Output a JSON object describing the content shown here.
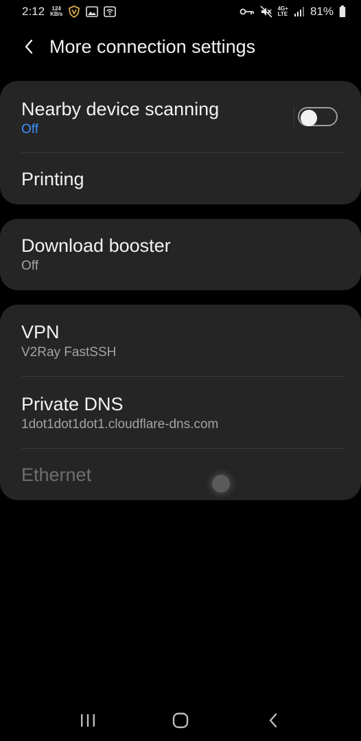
{
  "status_bar": {
    "time": "2:12",
    "net_speed_value": "124",
    "net_speed_unit": "KB/s",
    "lte_top": "4G+",
    "lte_bottom": "LTE",
    "battery": "81%"
  },
  "header": {
    "title": "More connection settings"
  },
  "card1": {
    "nearby": {
      "title": "Nearby device scanning",
      "subtitle": "Off",
      "toggle_on": false
    },
    "printing": {
      "title": "Printing"
    }
  },
  "card2": {
    "booster": {
      "title": "Download booster",
      "subtitle": "Off"
    }
  },
  "card3": {
    "vpn": {
      "title": "VPN",
      "subtitle": "V2Ray FastSSH"
    },
    "dns": {
      "title": "Private DNS",
      "subtitle": "1dot1dot1dot1.cloudflare-dns.com"
    },
    "ethernet": {
      "title": "Ethernet"
    }
  },
  "colors": {
    "accent": "#3e91ff",
    "card_bg": "#252525",
    "background": "#000000"
  }
}
